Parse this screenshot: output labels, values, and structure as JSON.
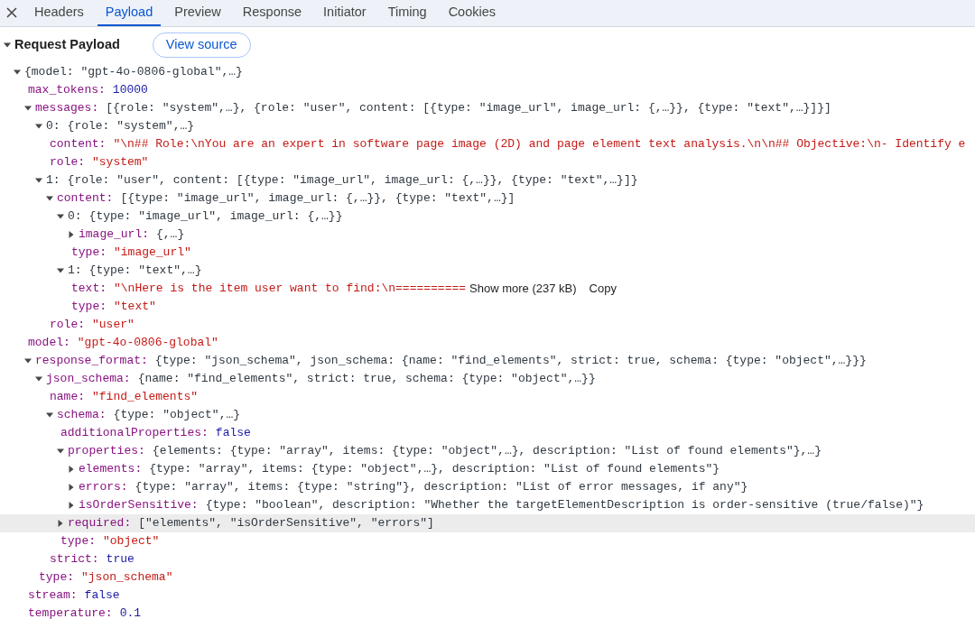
{
  "tabs": [
    {
      "label": "Headers",
      "selected": false
    },
    {
      "label": "Payload",
      "selected": true
    },
    {
      "label": "Preview",
      "selected": false
    },
    {
      "label": "Response",
      "selected": false
    },
    {
      "label": "Initiator",
      "selected": false
    },
    {
      "label": "Timing",
      "selected": false
    },
    {
      "label": "Cookies",
      "selected": false
    }
  ],
  "section": {
    "title": "Request Payload",
    "expanded": true,
    "button": "View source"
  },
  "tree": [
    {
      "value": "{model: \"gpt-4o-0806-global\",…}",
      "kind": "preview",
      "expanded": true,
      "selected": false,
      "children": [
        {
          "key": "max_tokens:",
          "value": "10000",
          "kind": "number",
          "selected": false
        },
        {
          "key": "messages:",
          "value": "[{role: \"system\",…}, {role: \"user\", content: [{type: \"image_url\", image_url: {,…}}, {type: \"text\",…}]}]",
          "kind": "preview",
          "expanded": true,
          "selected": false,
          "children": [
            {
              "index": "0:",
              "value": "{role: \"system\",…}",
              "kind": "preview",
              "expanded": true,
              "selected": false,
              "children": [
                {
                  "key": "content:",
                  "value": "\"\\n## Role:\\nYou are an expert in software page image (2D) and page element text analysis.\\n\\n## Objective:\\n- Identify e",
                  "kind": "string",
                  "selected": false
                },
                {
                  "key": "role:",
                  "value": "\"system\"",
                  "kind": "string",
                  "selected": false
                }
              ]
            },
            {
              "index": "1:",
              "value": "{role: \"user\", content: [{type: \"image_url\", image_url: {,…}}, {type: \"text\",…}]}",
              "kind": "preview",
              "expanded": true,
              "selected": false,
              "children": [
                {
                  "key": "content:",
                  "value": "[{type: \"image_url\", image_url: {,…}}, {type: \"text\",…}]",
                  "kind": "preview",
                  "expanded": true,
                  "selected": false,
                  "children": [
                    {
                      "index": "0:",
                      "value": "{type: \"image_url\", image_url: {,…}}",
                      "kind": "preview",
                      "expanded": true,
                      "selected": false,
                      "children": [
                        {
                          "key": "image_url:",
                          "value": "{,…}",
                          "kind": "preview",
                          "expanded": false,
                          "selected": false
                        },
                        {
                          "key": "type:",
                          "value": "\"image_url\"",
                          "kind": "string",
                          "selected": false
                        }
                      ]
                    },
                    {
                      "index": "1:",
                      "value": "{type: \"text\",…}",
                      "kind": "preview",
                      "expanded": true,
                      "selected": false,
                      "children": [
                        {
                          "key": "text:",
                          "value": "\"\\nHere is the item user want to find:\\n==========",
                          "kind": "string",
                          "selected": false,
                          "show_more": "Show more (237 kB)",
                          "copy": "Copy"
                        },
                        {
                          "key": "type:",
                          "value": "\"text\"",
                          "kind": "string",
                          "selected": false
                        }
                      ]
                    }
                  ]
                },
                {
                  "key": "role:",
                  "value": "\"user\"",
                  "kind": "string",
                  "selected": false
                }
              ]
            }
          ]
        },
        {
          "key": "model:",
          "value": "\"gpt-4o-0806-global\"",
          "kind": "string",
          "selected": false
        },
        {
          "key": "response_format:",
          "value": "{type: \"json_schema\", json_schema: {name: \"find_elements\", strict: true, schema: {type: \"object\",…}}}",
          "kind": "preview",
          "expanded": true,
          "selected": false,
          "children": [
            {
              "key": "json_schema:",
              "value": "{name: \"find_elements\", strict: true, schema: {type: \"object\",…}}",
              "kind": "preview",
              "expanded": true,
              "selected": false,
              "children": [
                {
                  "key": "name:",
                  "value": "\"find_elements\"",
                  "kind": "string",
                  "selected": false
                },
                {
                  "key": "schema:",
                  "value": "{type: \"object\",…}",
                  "kind": "preview",
                  "expanded": true,
                  "selected": false,
                  "children": [
                    {
                      "key": "additionalProperties:",
                      "value": "false",
                      "kind": "literal",
                      "selected": false
                    },
                    {
                      "key": "properties:",
                      "value": "{elements: {type: \"array\", items: {type: \"object\",…}, description: \"List of found elements\"},…}",
                      "kind": "preview",
                      "expanded": true,
                      "selected": false,
                      "children": [
                        {
                          "key": "elements:",
                          "value": "{type: \"array\", items: {type: \"object\",…}, description: \"List of found elements\"}",
                          "kind": "preview",
                          "expanded": false,
                          "selected": false
                        },
                        {
                          "key": "errors:",
                          "value": "{type: \"array\", items: {type: \"string\"}, description: \"List of error messages, if any\"}",
                          "kind": "preview",
                          "expanded": false,
                          "selected": false
                        },
                        {
                          "key": "isOrderSensitive:",
                          "value": "{type: \"boolean\", description: \"Whether the targetElementDescription is order-sensitive (true/false)\"}",
                          "kind": "preview",
                          "expanded": false,
                          "selected": false
                        }
                      ]
                    },
                    {
                      "key": "required:",
                      "value": "[\"elements\", \"isOrderSensitive\", \"errors\"]",
                      "kind": "preview",
                      "expanded": false,
                      "selected": true
                    },
                    {
                      "key": "type:",
                      "value": "\"object\"",
                      "kind": "string",
                      "selected": false
                    }
                  ]
                },
                {
                  "key": "strict:",
                  "value": "true",
                  "kind": "literal",
                  "selected": false
                }
              ]
            },
            {
              "key": "type:",
              "value": "\"json_schema\"",
              "kind": "string",
              "selected": false
            }
          ]
        },
        {
          "key": "stream:",
          "value": "false",
          "kind": "literal",
          "selected": false
        },
        {
          "key": "temperature:",
          "value": "0.1",
          "kind": "number",
          "selected": false
        }
      ]
    }
  ]
}
